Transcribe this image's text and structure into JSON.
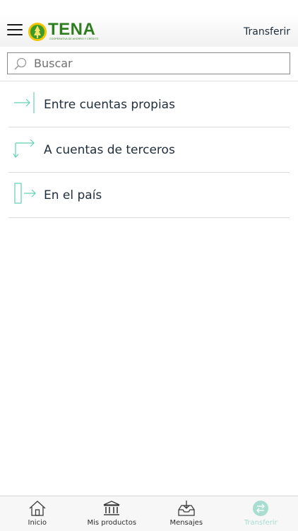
{
  "header": {
    "title": "Transferir",
    "logo_text": "TENA",
    "logo_subtext": "COOPERATIVA DE AHORRO Y CRÉDITO",
    "brand_color": "#2e7d1e",
    "menu_icon": "hamburger-menu-icon"
  },
  "search": {
    "placeholder": "Buscar",
    "value": "",
    "icon": "search-icon"
  },
  "menu": {
    "accent_color": "#5fd1b4",
    "items": [
      {
        "label": "Entre cuentas propias",
        "icon": "transfer-own-accounts-icon"
      },
      {
        "label": "A cuentas de terceros",
        "icon": "transfer-third-party-icon"
      },
      {
        "label": "En el país",
        "icon": "transfer-domestic-icon"
      }
    ]
  },
  "tabbar": {
    "active_color": "#a8ddd0",
    "tabs": [
      {
        "label": "Inicio",
        "icon": "home-icon",
        "active": false
      },
      {
        "label": "Mis productos",
        "icon": "bank-icon",
        "active": false
      },
      {
        "label": "Mensajes",
        "icon": "inbox-icon",
        "active": false
      },
      {
        "label": "Transferir",
        "icon": "transfer-icon",
        "active": true
      }
    ]
  }
}
